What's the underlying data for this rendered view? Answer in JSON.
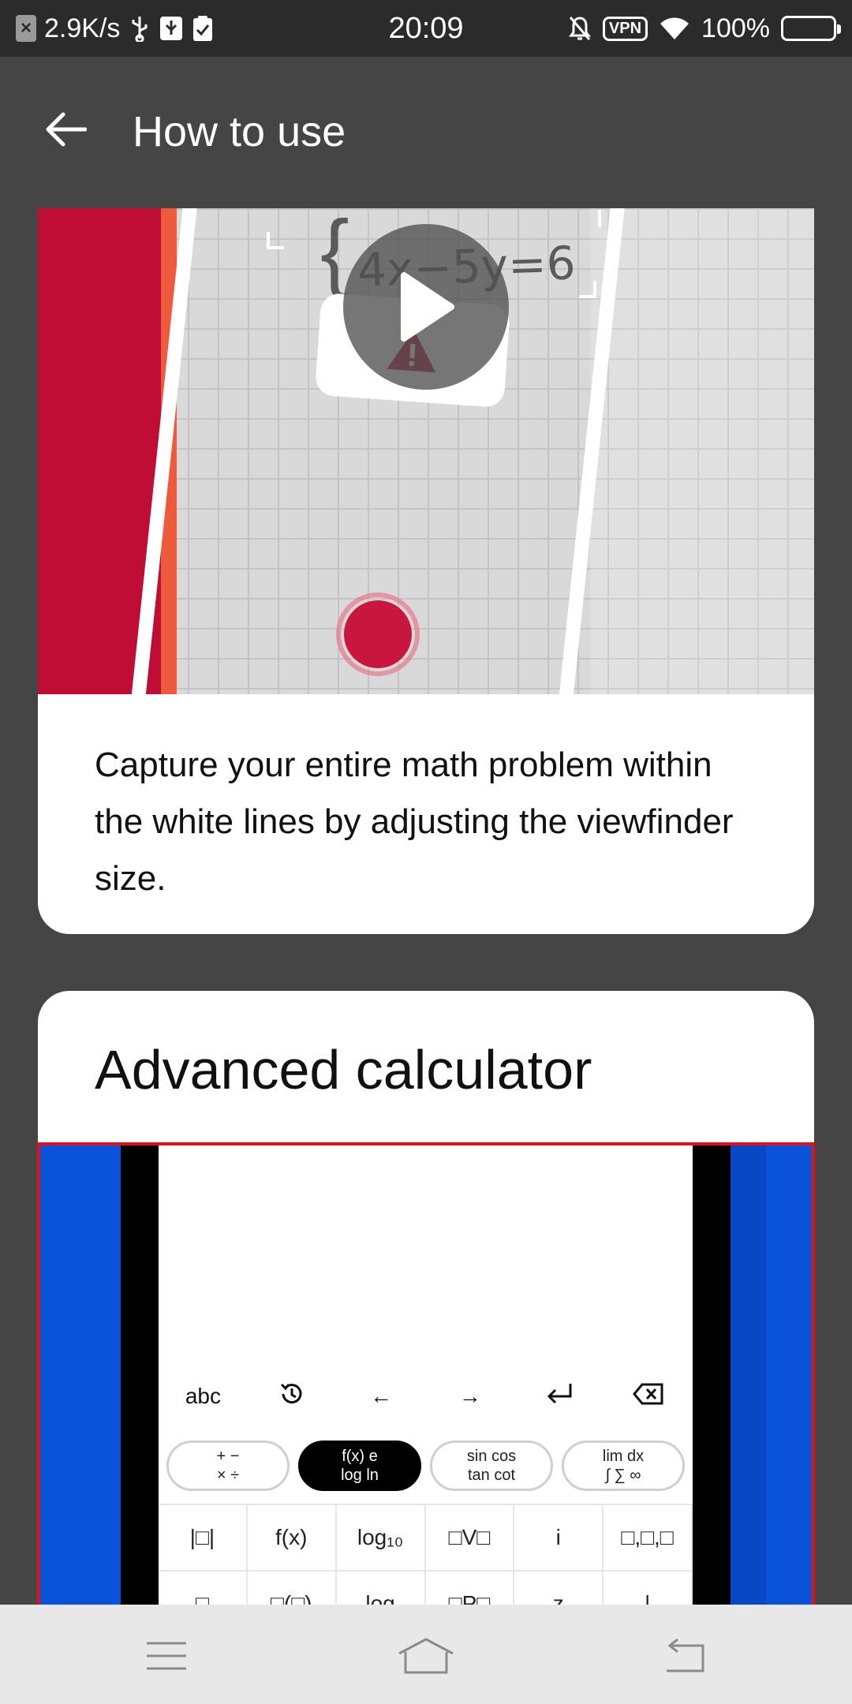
{
  "status_bar": {
    "speed": "2.9K/s",
    "time": "20:09",
    "vpn": "VPN",
    "battery": "100%",
    "battery_level": 1.0
  },
  "header": {
    "title": "How to use",
    "back_icon": "arrow-left-icon"
  },
  "card1": {
    "equation": "4x−5y=6",
    "description": "Capture your entire math problem within the white lines by adjusting the viewfinder size.",
    "play_icon": "play-icon"
  },
  "card2": {
    "title": "Advanced calculator",
    "toolbar": [
      "abc",
      "history-icon",
      "←",
      "→",
      "enter-icon",
      "backspace-icon"
    ],
    "categories": [
      {
        "line1": "+ −",
        "line2": "× ÷"
      },
      {
        "line1": "f(x)  e",
        "line2": "log  ln"
      },
      {
        "line1": "sin cos",
        "line2": "tan cot"
      },
      {
        "line1": "lim  dx",
        "line2": "∫ ∑ ∞"
      }
    ],
    "keys_row1": [
      "|□|",
      "f(x)",
      "log₁₀",
      "□V□",
      "i",
      "□,□,□"
    ],
    "keys_row2": [
      "□",
      "□(□)",
      "log",
      "□P□",
      "z",
      "|"
    ]
  },
  "colors": {
    "accent_red": "#c00d35",
    "calc_blue": "#0a52d8"
  }
}
